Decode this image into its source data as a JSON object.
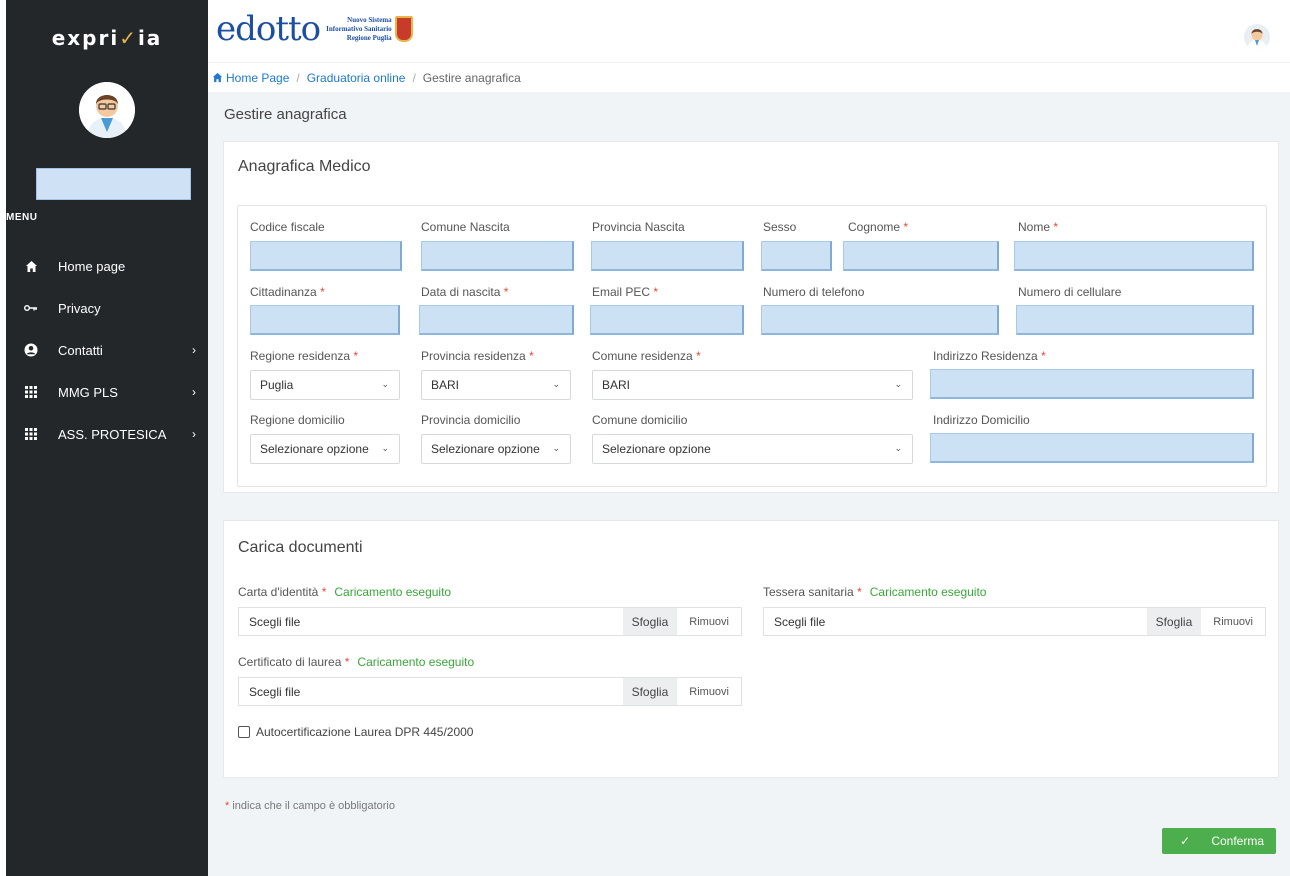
{
  "sidebar": {
    "logo_text_a": "expri",
    "logo_text_b": "ia",
    "menu_title": "MENU",
    "items": [
      {
        "label": "Home page",
        "icon": "home-icon"
      },
      {
        "label": "Privacy",
        "icon": "key-icon"
      },
      {
        "label": "Contatti",
        "icon": "user-circle-icon"
      },
      {
        "label": "MMG PLS",
        "icon": "grid-icon"
      },
      {
        "label": "ASS. PROTESICA",
        "icon": "grid-icon"
      }
    ]
  },
  "header": {
    "brand_name": "edotto",
    "brand_sub_1": "Nuovo Sistema",
    "brand_sub_2": "Informativo Sanitario",
    "brand_sub_3": "Regione Puglia"
  },
  "breadcrumb": {
    "home": "Home Page",
    "level1": "Graduatoria online",
    "current": "Gestire anagrafica",
    "separator": "/"
  },
  "page": {
    "title": "Gestire anagrafica"
  },
  "anagrafica": {
    "title": "Anagrafica Medico",
    "required_mark": "*",
    "fields": {
      "codice_fiscale": "Codice fiscale",
      "comune_nascita": "Comune Nascita",
      "provincia_nascita": "Provincia Nascita",
      "sesso": "Sesso",
      "cognome": "Cognome",
      "nome": "Nome",
      "cittadinanza": "Cittadinanza",
      "data_nascita": "Data di nascita",
      "email_pec": "Email PEC",
      "telefono": "Numero di telefono",
      "cellulare": "Numero di cellulare",
      "regione_residenza": "Regione residenza",
      "provincia_residenza": "Provincia residenza",
      "comune_residenza": "Comune residenza",
      "indirizzo_residenza": "Indirizzo Residenza",
      "regione_domicilio": "Regione domicilio",
      "provincia_domicilio": "Provincia domicilio",
      "comune_domicilio": "Comune domicilio",
      "indirizzo_domicilio": "Indirizzo Domicilio"
    },
    "values": {
      "regione_residenza": "Puglia",
      "provincia_residenza": "BARI",
      "comune_residenza": "BARI",
      "regione_domicilio": "Selezionare opzione",
      "provincia_domicilio": "Selezionare opzione",
      "comune_domicilio": "Selezionare opzione"
    }
  },
  "documenti": {
    "title": "Carica documenti",
    "status": "Caricamento eseguito",
    "file_placeholder": "Scegli file",
    "browse_label": "Sfoglia",
    "remove_label": "Rimuovi",
    "carta_identita": "Carta d'identità",
    "tessera_sanitaria": "Tessera sanitaria",
    "certificato_laurea": "Certificato di laurea",
    "autocert_label": "Autocertificazione Laurea DPR 445/2000",
    "autocert_checked": false
  },
  "footer": {
    "required_mark": "*",
    "note": "indica che il campo è obbligatorio",
    "confirm_label": "Conferma"
  },
  "colors": {
    "sidebar_bg": "#23272a",
    "accent_blue": "#1f78d1",
    "success_green": "#4cae4c",
    "required_red": "#e0493a"
  }
}
